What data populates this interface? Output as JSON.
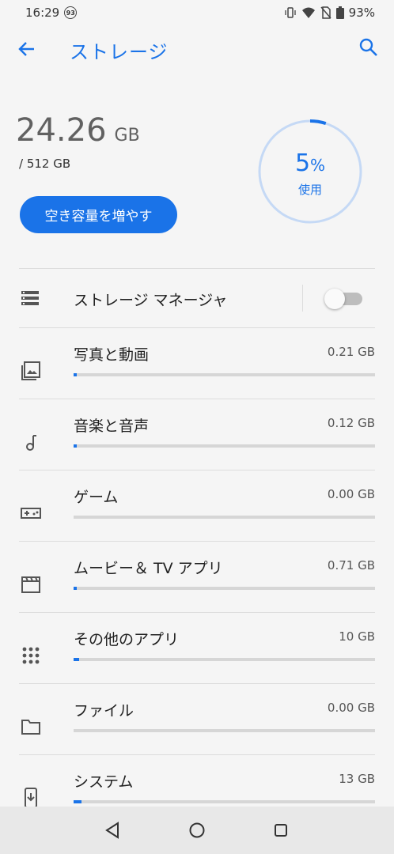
{
  "status_bar": {
    "time": "16:29",
    "notification_count": "93",
    "battery": "93%",
    "icons": [
      "vibrate-icon",
      "wifi-icon",
      "no-sim-icon",
      "battery-icon"
    ]
  },
  "app_bar": {
    "title": "ストレージ",
    "back_icon": "arrow-back-icon",
    "search_icon": "search-icon"
  },
  "summary": {
    "used_value": "24.26",
    "used_unit": "GB",
    "total": "/ 512 GB",
    "free_up_label": "空き容量を増やす",
    "percent_value": "5",
    "percent_sign": "%",
    "percent_label": "使用",
    "percent_used_fraction": 0.05
  },
  "storage_manager": {
    "label": "ストレージ マネージャ",
    "icon": "storage-manager-icon",
    "enabled": false
  },
  "categories": [
    {
      "label": "写真と動画",
      "size": "0.21 GB",
      "icon": "photo-icon",
      "fraction": 0.0004
    },
    {
      "label": "音楽と音声",
      "size": "0.12 GB",
      "icon": "music-note-icon",
      "fraction": 0.0002
    },
    {
      "label": "ゲーム",
      "size": "0.00 GB",
      "icon": "gamepad-icon",
      "fraction": 0
    },
    {
      "label": "ムービー＆ TV アプリ",
      "size": "0.71 GB",
      "icon": "movie-icon",
      "fraction": 0.0014
    },
    {
      "label": "その他のアプリ",
      "size": "10 GB",
      "icon": "apps-grid-icon",
      "fraction": 0.0195
    },
    {
      "label": "ファイル",
      "size": "0.00 GB",
      "icon": "folder-icon",
      "fraction": 0
    },
    {
      "label": "システム",
      "size": "13 GB",
      "icon": "system-phone-icon",
      "fraction": 0.0254
    }
  ],
  "colors": {
    "accent": "#1a73e8",
    "ring_track": "#c5d9f5",
    "background": "#f5f5f5"
  }
}
